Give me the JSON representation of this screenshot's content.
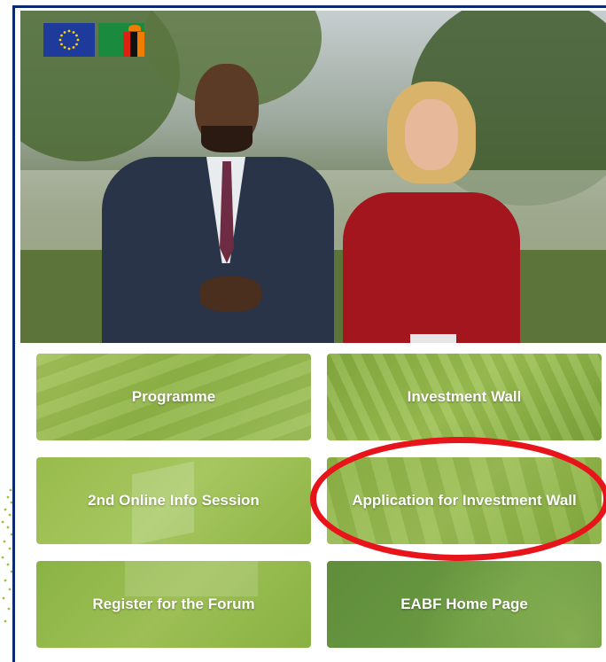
{
  "tiles": {
    "programme": "Programme",
    "investment_wall": "Investment Wall",
    "info_session": "2nd Online Info Session",
    "application": "Application for Investment Wall",
    "register": "Register for the Forum",
    "home": "EABF Home Page"
  },
  "colors": {
    "tile_green": "#8fb446",
    "dark_green": "#5d8a3a",
    "annotation_red": "#e8141b",
    "frame_navy": "#0b2a6f"
  },
  "icons": [
    "eu-flag-icon",
    "zambia-flag-icon"
  ]
}
